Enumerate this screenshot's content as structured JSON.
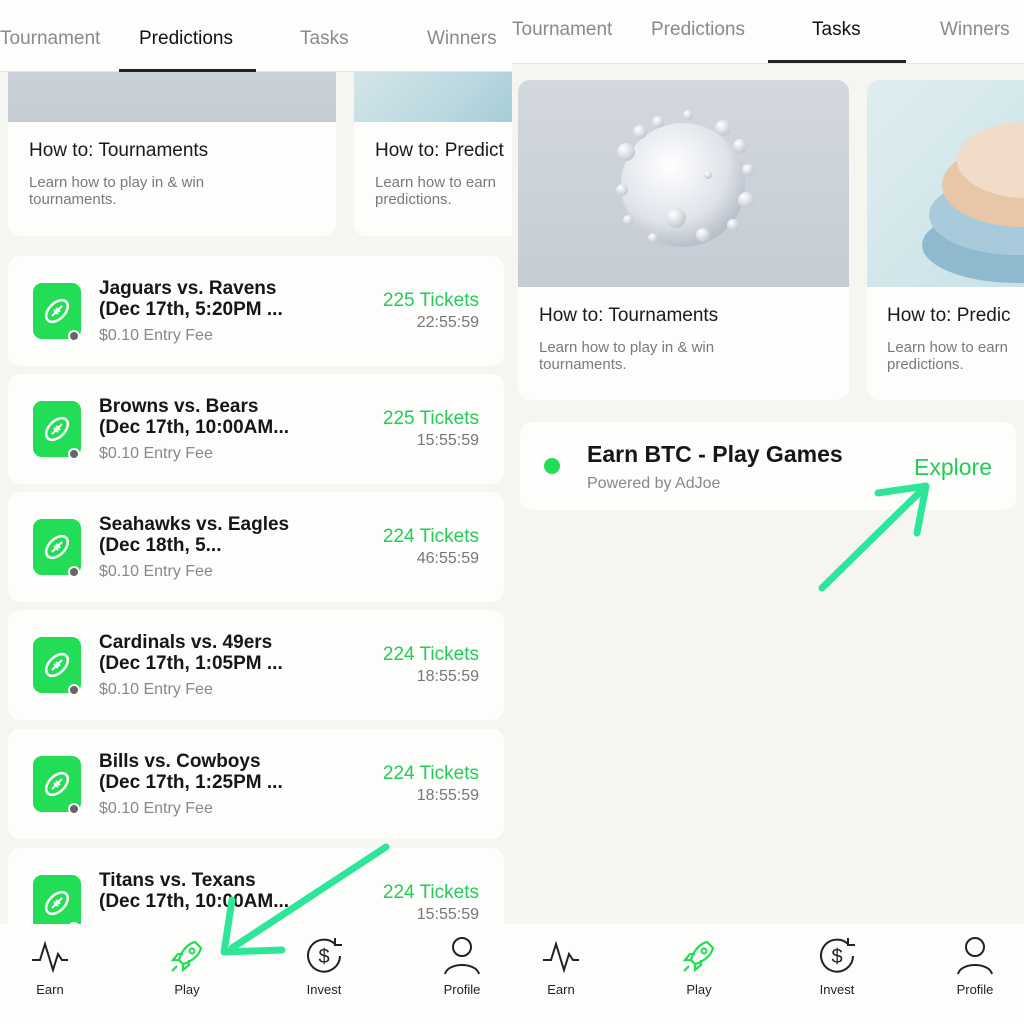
{
  "left": {
    "tabs": [
      "Tournament",
      "Predictions",
      "Tasks",
      "Winners"
    ],
    "active_tab": "Predictions",
    "howto_cards": [
      {
        "title": "How to: Tournaments",
        "desc": "Learn how to play in & win tournaments."
      },
      {
        "title": "How to: Predict",
        "desc": "Learn how to earn predictions."
      }
    ],
    "games": [
      {
        "title": "Jaguars vs. Ravens (Dec 17th, 5:20PM ...",
        "fee": "$0.10 Entry Fee",
        "tickets": "225 Tickets",
        "time": "22:55:59"
      },
      {
        "title": "Browns vs. Bears (Dec 17th, 10:00AM...",
        "fee": "$0.10 Entry Fee",
        "tickets": "225 Tickets",
        "time": "15:55:59"
      },
      {
        "title": "Seahawks vs. Eagles (Dec 18th, 5...",
        "fee": "$0.10 Entry Fee",
        "tickets": "224 Tickets",
        "time": "46:55:59"
      },
      {
        "title": "Cardinals vs. 49ers (Dec 17th, 1:05PM ...",
        "fee": "$0.10 Entry Fee",
        "tickets": "224 Tickets",
        "time": "18:55:59"
      },
      {
        "title": "Bills vs. Cowboys (Dec 17th, 1:25PM ...",
        "fee": "$0.10 Entry Fee",
        "tickets": "224 Tickets",
        "time": "18:55:59"
      },
      {
        "title": "Titans vs. Texans (Dec 17th, 10:00AM...",
        "fee": "",
        "tickets": "224 Tickets",
        "time": "15:55:59"
      }
    ],
    "nav": {
      "earn": "Earn",
      "play": "Play",
      "invest": "Invest",
      "profile": "Profile"
    },
    "active_nav": "Play"
  },
  "right": {
    "tabs": [
      "Tournament",
      "Predictions",
      "Tasks",
      "Winners"
    ],
    "active_tab": "Tasks",
    "howto_cards": [
      {
        "title": "How to: Tournaments",
        "desc": "Learn how to play in & win tournaments."
      },
      {
        "title": "How to: Predic",
        "desc": "Learn how to earn predictions."
      }
    ],
    "task": {
      "title": "Earn BTC - Play Games",
      "subtitle": "Powered by AdJoe",
      "action": "Explore"
    },
    "nav": {
      "earn": "Earn",
      "play": "Play",
      "invest": "Invest",
      "profile": "Profile"
    },
    "active_nav": "Play"
  },
  "colors": {
    "accent": "#22DD55",
    "annotation_arrow": "#2EE69A",
    "text": "#161616",
    "muted": "#888888"
  }
}
